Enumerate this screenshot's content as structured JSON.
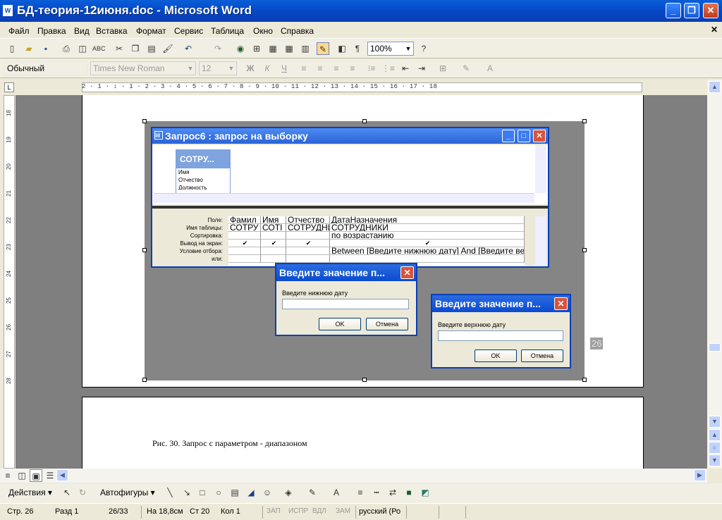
{
  "window": {
    "title": "БД-теория-12июня.doc - Microsoft Word"
  },
  "menu": [
    "Файл",
    "Правка",
    "Вид",
    "Вставка",
    "Формат",
    "Сервис",
    "Таблица",
    "Окно",
    "Справка"
  ],
  "toolbar": {
    "zoom": "100%"
  },
  "format": {
    "style": "Обычный",
    "font": "Times New Roman",
    "size": "12"
  },
  "ruler": {
    "marks": "2 · 1 · ↕ · 1 · 2 · 3 · 4 · 5 · 6 · 7 · 8 · 9 · 10 · 11 · 12 · 13 · 14 · 15 · 16 · 17 · 18"
  },
  "vruler": {
    "marks": [
      "18",
      "19",
      "20",
      "21",
      "22",
      "23",
      "24",
      "25",
      "26",
      "27",
      "28"
    ]
  },
  "query_window": {
    "title": "Запрос6 : запрос на выборку",
    "table_name": "СОТРУ...",
    "table_fields": [
      "Имя",
      "Отчество",
      "Должность"
    ],
    "row_labels": [
      "Поле:",
      "Имя таблицы:",
      "Сортировка:",
      "Вывод на экран:",
      "Условие отбора:",
      "или:"
    ],
    "columns": [
      {
        "field": "Фамил",
        "table": "СОТРУ",
        "sort": "",
        "show": "✔",
        "criteria": ""
      },
      {
        "field": "Имя",
        "table": "СОТІ",
        "sort": "",
        "show": "✔",
        "criteria": ""
      },
      {
        "field": "Отчество",
        "table": "СОТРУДНИ",
        "sort": "",
        "show": "✔",
        "criteria": ""
      },
      {
        "field": "ДатаНазначения",
        "table": "СОТРУДНИКИ",
        "sort": "по возрастанию",
        "show": "✔",
        "criteria": "Between [Введите нижнюю дату] And [Введите верхнюю  дату ]"
      }
    ]
  },
  "dialog1": {
    "title": "Введите значение п...",
    "label": "Введите нижнюю дату",
    "ok": "OK",
    "cancel": "Отмена"
  },
  "dialog2": {
    "title": "Введите значение п...",
    "label": "Введите верхнюю  дату",
    "ok": "OK",
    "cancel": "Отмена"
  },
  "page_number": "26",
  "caption": "Рис. 30. Запрос с параметром - диапазоном",
  "drawbar": {
    "actions": "Действия ▾",
    "autoshapes": "Автофигуры ▾"
  },
  "status": {
    "page": "Стр. 26",
    "section": "Разд 1",
    "pages": "26/33",
    "at": "На 18,8см",
    "line": "Ст 20",
    "col": "Кол 1",
    "rec": "ЗАП",
    "trk": "ИСПР",
    "ext": "ВДЛ",
    "ovr": "ЗАМ",
    "lang": "русский (Ро"
  }
}
